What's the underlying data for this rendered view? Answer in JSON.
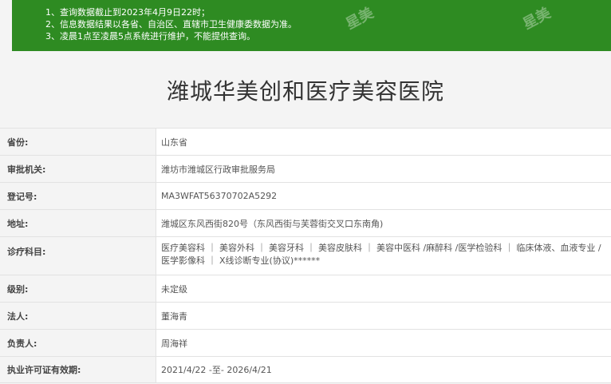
{
  "notice": {
    "lines": [
      "1、查询数据截止到2023年4月9日22时；",
      "2、信息数据结果以各省、自治区、直辖市卫生健康委数据为准。",
      "3、凌晨1点至凌晨5点系统进行维护，不能提供查询。"
    ],
    "watermark": "星美"
  },
  "hospital": {
    "name": "潍城华美创和医疗美容医院"
  },
  "fields": [
    {
      "label": "省份:",
      "value": "山东省"
    },
    {
      "label": "审批机关:",
      "value": "潍坊市潍城区行政审批服务局"
    },
    {
      "label": "登记号:",
      "value": "MA3WFAT56370702A5292"
    },
    {
      "label": "地址:",
      "value": "潍城区东风西街820号（东风西街与芙蓉街交叉口东南角)"
    },
    {
      "label": "诊疗科目:",
      "value": "医疗美容科 ｜ 美容外科 ｜ 美容牙科 ｜ 美容皮肤科 ｜ 美容中医科 /麻醉科 /医学检验科 ｜ 临床体液、血液专业 / 医学影像科 ｜ X线诊断专业(协议)******"
    },
    {
      "label": "级别:",
      "value": "未定级"
    },
    {
      "label": "法人:",
      "value": "董海青"
    },
    {
      "label": "负责人:",
      "value": "周海祥"
    },
    {
      "label": "执业许可证有效期:",
      "value": "2021/4/22 -至- 2026/4/21"
    }
  ]
}
